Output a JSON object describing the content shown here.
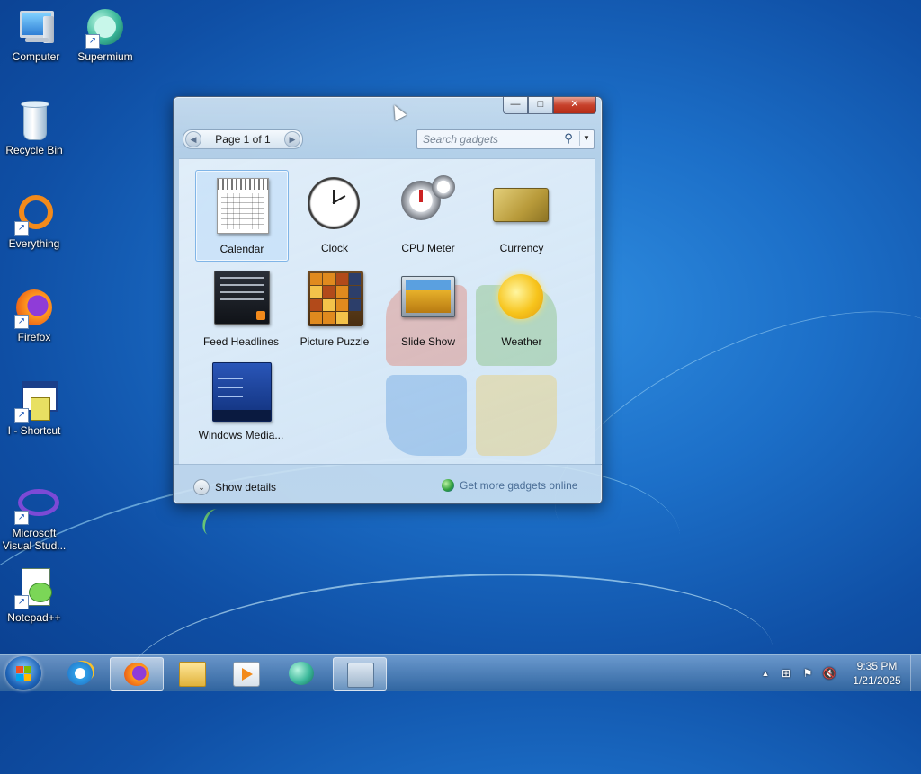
{
  "desktop": {
    "icons": [
      {
        "label": "Computer"
      },
      {
        "label": "Supermium"
      },
      {
        "label": "Recycle Bin"
      },
      {
        "label": "Everything"
      },
      {
        "label": "Firefox"
      },
      {
        "label": "I - Shortcut"
      },
      {
        "label": "Microsoft Visual Stud..."
      },
      {
        "label": "Notepad++"
      }
    ]
  },
  "gadget_window": {
    "caption": {
      "minimize": "—",
      "maximize": "□",
      "close": "✕"
    },
    "pager": {
      "text": "Page 1 of 1",
      "prev": "◀",
      "next": "▶"
    },
    "search": {
      "placeholder": "Search gadgets",
      "icon": "⚲",
      "dropdown": "▼"
    },
    "gadgets": [
      {
        "name": "Calendar",
        "selected": true
      },
      {
        "name": "Clock"
      },
      {
        "name": "CPU Meter"
      },
      {
        "name": "Currency"
      },
      {
        "name": "Feed Headlines"
      },
      {
        "name": "Picture Puzzle"
      },
      {
        "name": "Slide Show"
      },
      {
        "name": "Weather"
      },
      {
        "name": "Windows Media..."
      }
    ],
    "calendar_thumb_month": "OCTOBER",
    "wmc_items": [
      "Movies",
      "Television",
      "Music"
    ],
    "show_details": "Show details",
    "show_details_icon": "⌄",
    "get_more": "Get more gadgets online"
  },
  "taskbar": {
    "start_label": "Start",
    "buttons": [
      {
        "name": "internet-explorer",
        "active": false
      },
      {
        "name": "firefox",
        "active": true
      },
      {
        "name": "file-explorer",
        "active": false
      },
      {
        "name": "media-player",
        "active": false
      },
      {
        "name": "supermium",
        "active": false
      },
      {
        "name": "desktop-gadgets",
        "active": true
      }
    ],
    "tray": {
      "show_hidden": "▲",
      "network": "⊞",
      "flag": "⚑",
      "volume": "🔇"
    },
    "clock": {
      "time": "9:35 PM",
      "date": "1/21/2025"
    }
  },
  "colors": {
    "desktop_bg": "#1c6fc8",
    "close_button": "#c7412b",
    "link": "#4a6d96"
  }
}
